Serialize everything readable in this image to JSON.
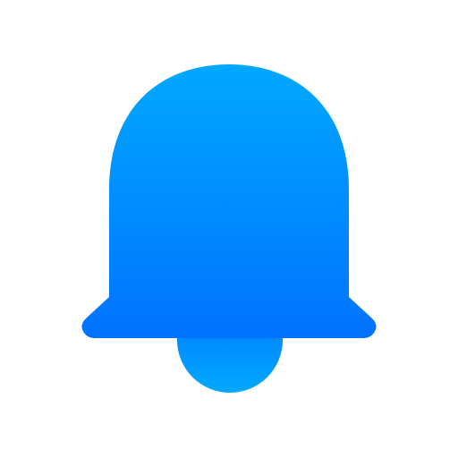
{
  "icon": {
    "name": "bell-icon",
    "colors": {
      "body_top": "#00A8FF",
      "body_bottom": "#0072FF",
      "clapper_top": "#0088FF",
      "clapper_bottom": "#00A8FF",
      "background": "#FFFFFF"
    }
  }
}
